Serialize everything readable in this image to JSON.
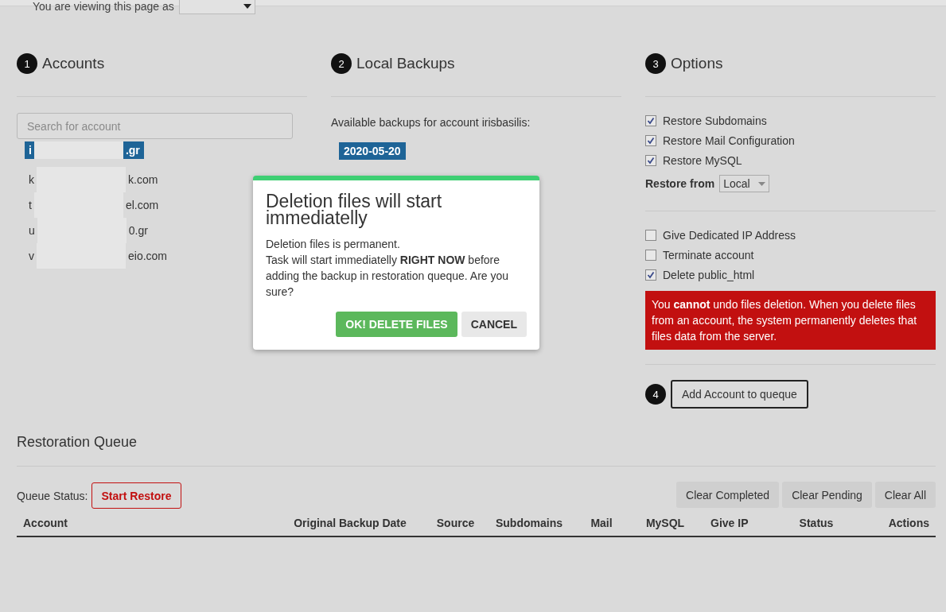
{
  "viewing_as": {
    "label": "You are viewing this page as"
  },
  "steps": [
    {
      "number": "1",
      "title": "Accounts"
    },
    {
      "number": "2",
      "title": "Local Backups"
    },
    {
      "number": "3",
      "title": "Options"
    },
    {
      "number": "4"
    }
  ],
  "accounts": {
    "search_placeholder": "Search for account",
    "items": [
      {
        "start": "i",
        "end": ".gr",
        "selected": true
      },
      {
        "start": "k",
        "end": "k.com",
        "selected": false
      },
      {
        "start": "t",
        "end": "el.com",
        "selected": false
      },
      {
        "start": "u",
        "end": "0.gr",
        "selected": false
      },
      {
        "start": "v",
        "end": "eio.com",
        "selected": false
      }
    ]
  },
  "backups": {
    "caption": "Available backups for account irisbasilis:",
    "dates": [
      {
        "label": "2020-05-20",
        "selected": true
      }
    ]
  },
  "options": {
    "restore": [
      {
        "label": "Restore Subdomains",
        "checked": true
      },
      {
        "label": "Restore Mail Configuration",
        "checked": true
      },
      {
        "label": "Restore MySQL",
        "checked": true
      }
    ],
    "restore_from": {
      "label": "Restore from",
      "value": "Local"
    },
    "extra": [
      {
        "label": "Give Dedicated IP Address",
        "checked": false
      },
      {
        "label": "Terminate account",
        "checked": false
      },
      {
        "label": "Delete public_html",
        "checked": true
      }
    ],
    "warning": "You **cannot** undo files deletion. When you delete files from an account, the system permanently deletes that files data from the server.",
    "add_button": "Add Account to queque"
  },
  "queue": {
    "title": "Restoration Queue",
    "status_label": "Queue Status:",
    "start_button": "Start Restore",
    "clear_buttons": [
      "Clear Completed",
      "Clear Pending",
      "Clear All"
    ],
    "columns": [
      "Account",
      "Original Backup Date",
      "Source",
      "Subdomains",
      "Mail",
      "MySQL",
      "Give IP",
      "Status",
      "Actions"
    ]
  },
  "dialog": {
    "title": "Deletion files will start immediatelly",
    "lines": [
      "Deletion files is permanent.",
      "Task will start immediatelly **RIGHT NOW** before adding the backup in restoration queque. Are you sure?"
    ],
    "confirm": "OK! DELETE FILES",
    "cancel": "CANCEL"
  }
}
